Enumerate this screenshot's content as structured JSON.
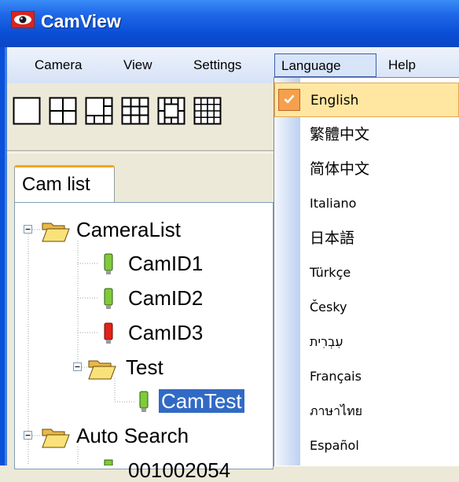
{
  "window": {
    "title": "CamView"
  },
  "menubar": {
    "items": [
      {
        "label": "Camera"
      },
      {
        "label": "View"
      },
      {
        "label": "Settings"
      },
      {
        "label": "Language"
      },
      {
        "label": "Help"
      }
    ],
    "active": "Language"
  },
  "toolbar": {
    "layout_buttons": [
      "1-view-layout",
      "4-view-layout",
      "6-view-layout",
      "9-view-layout",
      "8-view-layout",
      "16-view-layout"
    ]
  },
  "tabs": [
    {
      "label": "Cam list"
    }
  ],
  "tree": {
    "nodes": [
      {
        "label": "CameraList",
        "type": "folder",
        "expanded": true
      },
      {
        "label": "CamID1",
        "type": "camera",
        "status": "green"
      },
      {
        "label": "CamID2",
        "type": "camera",
        "status": "green"
      },
      {
        "label": "CamID3",
        "type": "camera",
        "status": "red"
      },
      {
        "label": "Test",
        "type": "folder",
        "expanded": true
      },
      {
        "label": "CamTest",
        "type": "camera",
        "status": "green",
        "selected": true
      },
      {
        "label": "Auto Search",
        "type": "folder",
        "expanded": true
      },
      {
        "label": "001002054",
        "type": "camera",
        "status": "green"
      }
    ]
  },
  "language_menu": {
    "items": [
      {
        "label": "English",
        "checked": true
      },
      {
        "label": "繁體中文"
      },
      {
        "label": "简体中文"
      },
      {
        "label": "Italiano"
      },
      {
        "label": "日本語"
      },
      {
        "label": "Türkçe"
      },
      {
        "label": "Česky"
      },
      {
        "label": "עִבְרִית"
      },
      {
        "label": "Français"
      },
      {
        "label": "ภาษาไทย"
      },
      {
        "label": "Español"
      }
    ]
  },
  "colors": {
    "titlebar": "#0A4FD6",
    "selection": "#316AC5",
    "menu_highlight": "#FFE7A2",
    "check_bg": "#F5A04C",
    "tab_accent": "#F5A623"
  }
}
